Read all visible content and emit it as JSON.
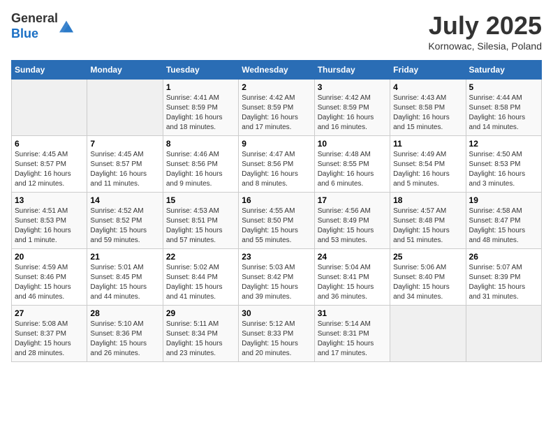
{
  "header": {
    "logo_general": "General",
    "logo_blue": "Blue",
    "month_title": "July 2025",
    "location": "Kornowac, Silesia, Poland"
  },
  "days_of_week": [
    "Sunday",
    "Monday",
    "Tuesday",
    "Wednesday",
    "Thursday",
    "Friday",
    "Saturday"
  ],
  "weeks": [
    [
      {
        "day": "",
        "info": ""
      },
      {
        "day": "",
        "info": ""
      },
      {
        "day": "1",
        "sunrise": "4:41 AM",
        "sunset": "8:59 PM",
        "daylight": "16 hours and 18 minutes."
      },
      {
        "day": "2",
        "sunrise": "4:42 AM",
        "sunset": "8:59 PM",
        "daylight": "16 hours and 17 minutes."
      },
      {
        "day": "3",
        "sunrise": "4:42 AM",
        "sunset": "8:59 PM",
        "daylight": "16 hours and 16 minutes."
      },
      {
        "day": "4",
        "sunrise": "4:43 AM",
        "sunset": "8:58 PM",
        "daylight": "16 hours and 15 minutes."
      },
      {
        "day": "5",
        "sunrise": "4:44 AM",
        "sunset": "8:58 PM",
        "daylight": "16 hours and 14 minutes."
      }
    ],
    [
      {
        "day": "6",
        "sunrise": "4:45 AM",
        "sunset": "8:57 PM",
        "daylight": "16 hours and 12 minutes."
      },
      {
        "day": "7",
        "sunrise": "4:45 AM",
        "sunset": "8:57 PM",
        "daylight": "16 hours and 11 minutes."
      },
      {
        "day": "8",
        "sunrise": "4:46 AM",
        "sunset": "8:56 PM",
        "daylight": "16 hours and 9 minutes."
      },
      {
        "day": "9",
        "sunrise": "4:47 AM",
        "sunset": "8:56 PM",
        "daylight": "16 hours and 8 minutes."
      },
      {
        "day": "10",
        "sunrise": "4:48 AM",
        "sunset": "8:55 PM",
        "daylight": "16 hours and 6 minutes."
      },
      {
        "day": "11",
        "sunrise": "4:49 AM",
        "sunset": "8:54 PM",
        "daylight": "16 hours and 5 minutes."
      },
      {
        "day": "12",
        "sunrise": "4:50 AM",
        "sunset": "8:53 PM",
        "daylight": "16 hours and 3 minutes."
      }
    ],
    [
      {
        "day": "13",
        "sunrise": "4:51 AM",
        "sunset": "8:53 PM",
        "daylight": "16 hours and 1 minute."
      },
      {
        "day": "14",
        "sunrise": "4:52 AM",
        "sunset": "8:52 PM",
        "daylight": "15 hours and 59 minutes."
      },
      {
        "day": "15",
        "sunrise": "4:53 AM",
        "sunset": "8:51 PM",
        "daylight": "15 hours and 57 minutes."
      },
      {
        "day": "16",
        "sunrise": "4:55 AM",
        "sunset": "8:50 PM",
        "daylight": "15 hours and 55 minutes."
      },
      {
        "day": "17",
        "sunrise": "4:56 AM",
        "sunset": "8:49 PM",
        "daylight": "15 hours and 53 minutes."
      },
      {
        "day": "18",
        "sunrise": "4:57 AM",
        "sunset": "8:48 PM",
        "daylight": "15 hours and 51 minutes."
      },
      {
        "day": "19",
        "sunrise": "4:58 AM",
        "sunset": "8:47 PM",
        "daylight": "15 hours and 48 minutes."
      }
    ],
    [
      {
        "day": "20",
        "sunrise": "4:59 AM",
        "sunset": "8:46 PM",
        "daylight": "15 hours and 46 minutes."
      },
      {
        "day": "21",
        "sunrise": "5:01 AM",
        "sunset": "8:45 PM",
        "daylight": "15 hours and 44 minutes."
      },
      {
        "day": "22",
        "sunrise": "5:02 AM",
        "sunset": "8:44 PM",
        "daylight": "15 hours and 41 minutes."
      },
      {
        "day": "23",
        "sunrise": "5:03 AM",
        "sunset": "8:42 PM",
        "daylight": "15 hours and 39 minutes."
      },
      {
        "day": "24",
        "sunrise": "5:04 AM",
        "sunset": "8:41 PM",
        "daylight": "15 hours and 36 minutes."
      },
      {
        "day": "25",
        "sunrise": "5:06 AM",
        "sunset": "8:40 PM",
        "daylight": "15 hours and 34 minutes."
      },
      {
        "day": "26",
        "sunrise": "5:07 AM",
        "sunset": "8:39 PM",
        "daylight": "15 hours and 31 minutes."
      }
    ],
    [
      {
        "day": "27",
        "sunrise": "5:08 AM",
        "sunset": "8:37 PM",
        "daylight": "15 hours and 28 minutes."
      },
      {
        "day": "28",
        "sunrise": "5:10 AM",
        "sunset": "8:36 PM",
        "daylight": "15 hours and 26 minutes."
      },
      {
        "day": "29",
        "sunrise": "5:11 AM",
        "sunset": "8:34 PM",
        "daylight": "15 hours and 23 minutes."
      },
      {
        "day": "30",
        "sunrise": "5:12 AM",
        "sunset": "8:33 PM",
        "daylight": "15 hours and 20 minutes."
      },
      {
        "day": "31",
        "sunrise": "5:14 AM",
        "sunset": "8:31 PM",
        "daylight": "15 hours and 17 minutes."
      },
      {
        "day": "",
        "info": ""
      },
      {
        "day": "",
        "info": ""
      }
    ]
  ]
}
